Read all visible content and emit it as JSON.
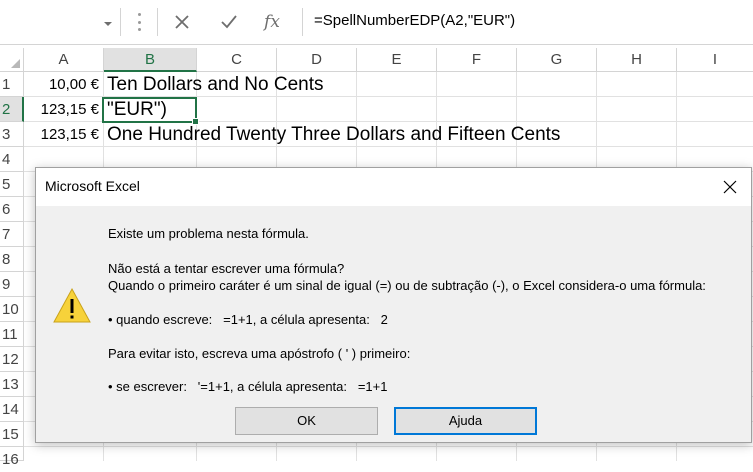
{
  "formula_bar": {
    "cancel_icon": "cancel-x-icon",
    "confirm_icon": "checkmark-icon",
    "fx_label": "fx",
    "formula": "=SpellNumberEDP(A2,\"EUR\")"
  },
  "columns": [
    "A",
    "B",
    "C",
    "D",
    "E",
    "F",
    "G",
    "H",
    "I"
  ],
  "rows": [
    "1",
    "2",
    "3",
    "4",
    "5",
    "6",
    "7",
    "8",
    "9",
    "10",
    "11",
    "12",
    "13",
    "14",
    "15",
    "16"
  ],
  "cells": {
    "A1": "10,00 €",
    "B1": "Ten Dollars and No Cents",
    "A2": "123,15 €",
    "B2": "\"EUR\")",
    "A3": "123,15 €",
    "B3": "One Hundred Twenty Three Dollars and Fifteen Cents"
  },
  "selection": {
    "column": "B",
    "row": "2"
  },
  "dialog": {
    "title": "Microsoft Excel",
    "icon": "warning-icon",
    "line1": "Existe um problema nesta fórmula.",
    "line2": "Não está a tentar escrever uma fórmula?",
    "line3": "Quando o primeiro caráter é um sinal de igual (=) ou de subtração (-), o Excel considera-o uma fórmula:",
    "line4": "• quando escreve:   =1+1, a célula apresenta:   2",
    "line5": "Para evitar isto, escreva uma apóstrofo ( ' ) primeiro:",
    "line6": "• se escrever:   '=1+1, a célula apresenta:   =1+1",
    "ok_label": "OK",
    "help_label": "Ajuda"
  },
  "colors": {
    "excel_green": "#217346",
    "focus_blue": "#0078d7",
    "warning_yellow": "#f7d23a"
  }
}
